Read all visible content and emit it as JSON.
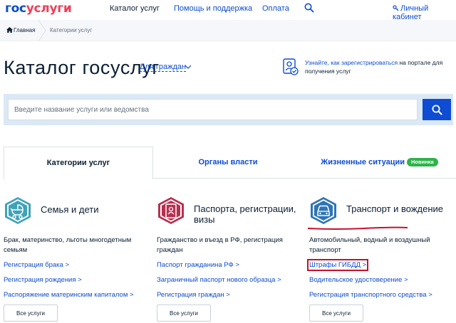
{
  "header": {
    "logo_part1": "гос",
    "logo_part2": "услуги",
    "nav": [
      "Каталог услуг",
      "Помощь и поддержка",
      "Оплата"
    ],
    "cabinet": "Личный кабинет"
  },
  "breadcrumb": {
    "home": "Главная",
    "current": "Категории услуг"
  },
  "title": {
    "text": "Каталог госуслуг",
    "audience": "Для граждан"
  },
  "register_hint": {
    "link": "Узнайте, как зарегистрироваться",
    "rest": " на портале для получения услуг"
  },
  "search": {
    "placeholder": "Введите название услуги или ведомства"
  },
  "tabs": {
    "categories": "Категории услуг",
    "authorities": "Органы власти",
    "life": "Жизненные ситуации",
    "badge": "Новинка"
  },
  "columns": [
    {
      "title": "Семья и дети",
      "desc": "Брак, материнство, льготы многодетным семьям",
      "links": [
        "Регистрация брака >",
        "Регистрация рождения >",
        "Распоряжение материнским капиталом >"
      ],
      "button": "Все услуги"
    },
    {
      "title": "Паспорта, регистрации, визы",
      "desc": "Гражданство и въезд в РФ, регистрация граждан",
      "links": [
        "Паспорт гражданина РФ >",
        "Заграничный паспорт нового образца >",
        "Регистрация граждан >"
      ],
      "button": "Все услуги"
    },
    {
      "title": "Транспорт и вождение",
      "desc": "Автомобильный, водный и воздушный транспорт",
      "links": [
        "Штрафы ГИБДД >",
        "Водительское удостоверение >",
        "Регистрация транспортного средства >"
      ],
      "button": "Все услуги"
    }
  ],
  "colors": {
    "brand_blue": "#0d4cd3",
    "brand_red": "#ee3f58",
    "family_teal": "#3fa3b8",
    "passport_crimson": "#b5304f",
    "transport_blue": "#2f74b5",
    "annotation_red": "#c8102e",
    "badge_green": "#2fb34b"
  }
}
